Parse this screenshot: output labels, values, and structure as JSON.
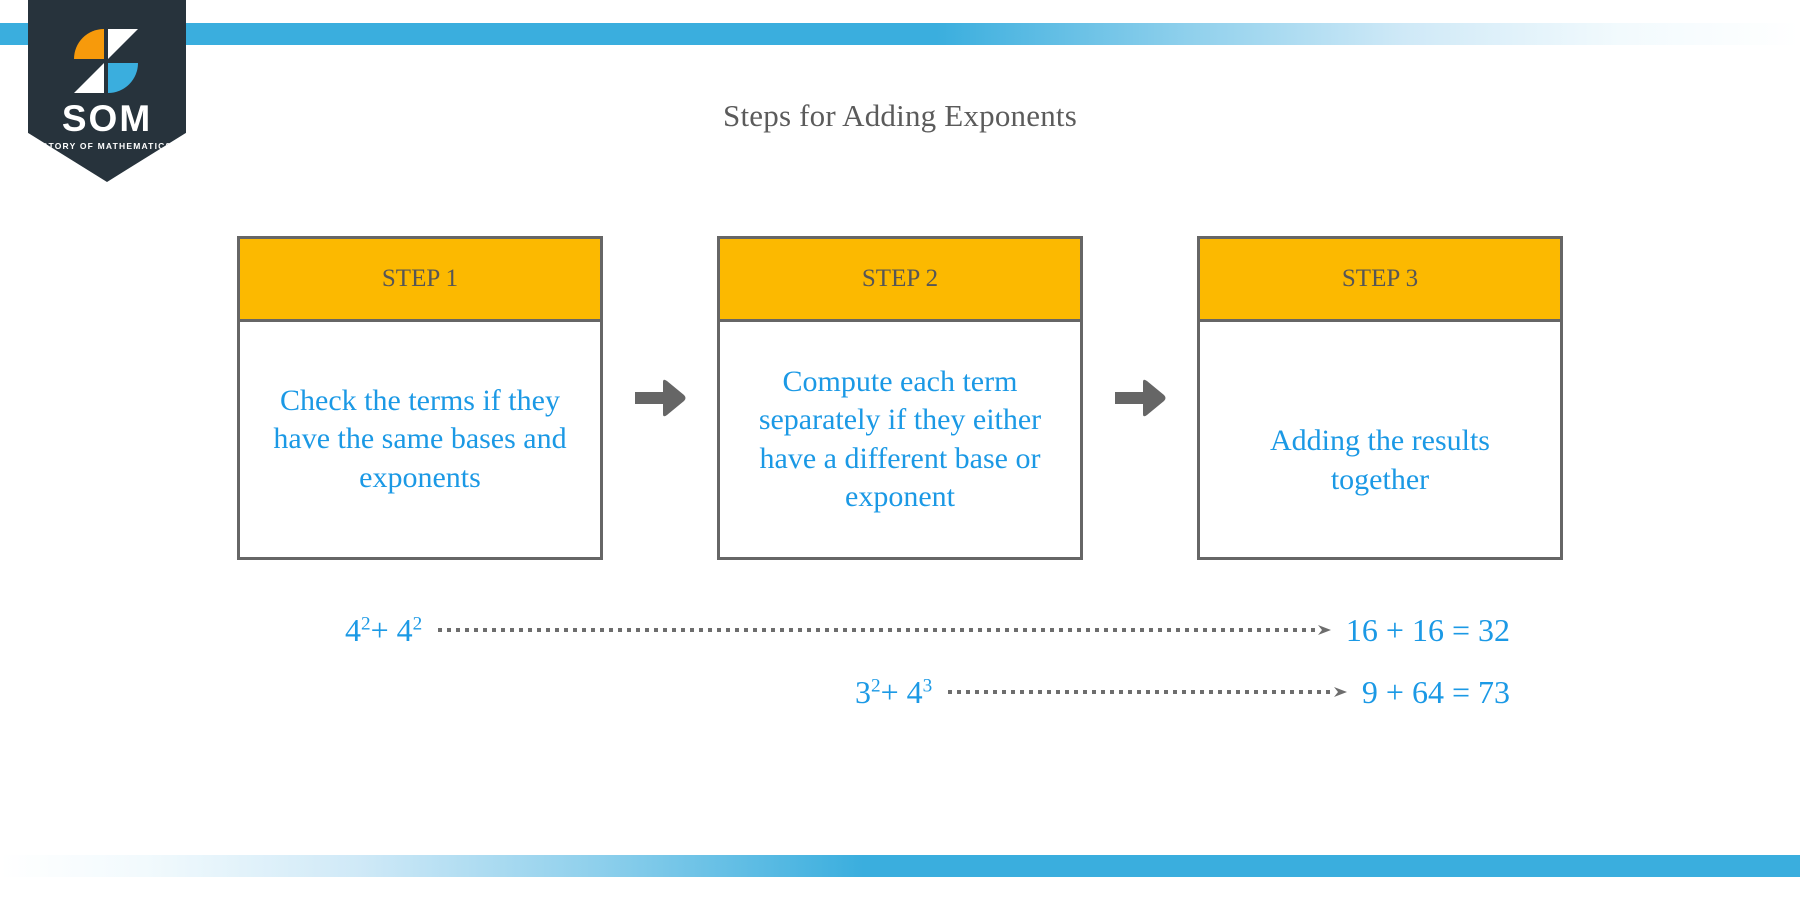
{
  "page": {
    "title": "Steps for Adding Exponents",
    "background_color": "#ffffff"
  },
  "brand": {
    "wordmark": "SOM",
    "tagline": "STORY OF MATHEMATICS",
    "ribbon_color": "#27333c",
    "logo_orange": "#f79a0b",
    "logo_blue": "#3aaede",
    "logo_white": "#ffffff"
  },
  "decor": {
    "band_top_color": "#3aaede",
    "band_bottom_color": "#3aaede"
  },
  "flow": {
    "accent_header_color": "#fcb900",
    "border_color": "#666666",
    "body_text_color": "#1b99e5",
    "header_text_color": "#565656",
    "steps": [
      {
        "header": "STEP 1",
        "body": "Check the terms if they have the same bases and exponents"
      },
      {
        "header": "STEP 2",
        "body": "Compute each term separately if they either have a different base or exponent"
      },
      {
        "header": "STEP 3",
        "body": "Adding the results together"
      }
    ],
    "connector_icon": "right-arrow-icon"
  },
  "examples": [
    {
      "expression_base_1": "4",
      "expression_exp_1": "2",
      "operator": "+",
      "expression_base_2": "4",
      "expression_exp_2": "2",
      "result": "16 + 16 = 32"
    },
    {
      "expression_base_1": "3",
      "expression_exp_1": "2",
      "operator": "+",
      "expression_base_2": "4",
      "expression_exp_2": "3",
      "result": "9 + 64 = 73"
    }
  ]
}
